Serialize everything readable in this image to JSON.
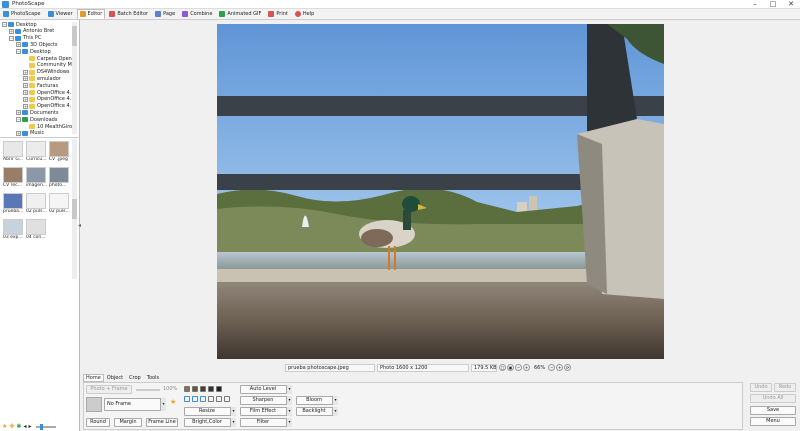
{
  "window": {
    "title": "PhotoScape",
    "minimize": "–",
    "maximize": "□",
    "close": "✕"
  },
  "tabs": [
    {
      "label": "PhotoScape",
      "color": "#3a8fd8"
    },
    {
      "label": "Viewer",
      "color": "#3a8fd8"
    },
    {
      "label": "Editor",
      "color": "#e39a2b"
    },
    {
      "label": "Batch Editor",
      "color": "#d9534f"
    },
    {
      "label": "Page",
      "color": "#5b7fd1"
    },
    {
      "label": "Combine",
      "color": "#8e5bd1"
    },
    {
      "label": "Animated GIF",
      "color": "#2e9e4f"
    },
    {
      "label": "Print",
      "color": "#d9534f"
    },
    {
      "label": "Help",
      "color": "#d9534f"
    }
  ],
  "tree": [
    {
      "label": "Desktop",
      "depth": 0,
      "expander": "−",
      "icon": "blue"
    },
    {
      "label": "Antonio Bret",
      "depth": 1,
      "expander": "+",
      "icon": "blue"
    },
    {
      "label": "This PC",
      "depth": 1,
      "expander": "−",
      "icon": "blue"
    },
    {
      "label": "3D Objects",
      "depth": 2,
      "expander": "+",
      "icon": "blue"
    },
    {
      "label": "Desktop",
      "depth": 2,
      "expander": "−",
      "icon": "blue"
    },
    {
      "label": "Carpeta Openf",
      "depth": 3,
      "expander": "",
      "icon": "folder"
    },
    {
      "label": "Community Ma",
      "depth": 3,
      "expander": "",
      "icon": "folder"
    },
    {
      "label": "DS4Windows",
      "depth": 3,
      "expander": "+",
      "icon": "folder"
    },
    {
      "label": "emulador",
      "depth": 3,
      "expander": "+",
      "icon": "folder"
    },
    {
      "label": "Facturas",
      "depth": 3,
      "expander": "+",
      "icon": "folder"
    },
    {
      "label": "OpenOffice 4.",
      "depth": 3,
      "expander": "+",
      "icon": "folder"
    },
    {
      "label": "OpenOffice 4.",
      "depth": 3,
      "expander": "+",
      "icon": "folder"
    },
    {
      "label": "OpenOffice 4.",
      "depth": 3,
      "expander": "+",
      "icon": "folder"
    },
    {
      "label": "Documents",
      "depth": 2,
      "expander": "+",
      "icon": "blue"
    },
    {
      "label": "Downloads",
      "depth": 2,
      "expander": "−",
      "icon": "green"
    },
    {
      "label": "10 MealthGiro",
      "depth": 3,
      "expander": "",
      "icon": "folder"
    },
    {
      "label": "Music",
      "depth": 2,
      "expander": "+",
      "icon": "blue"
    }
  ],
  "thumbnails": [
    {
      "label": "Abrir G...",
      "color": "#e8e8e8"
    },
    {
      "label": "Curricu...",
      "color": "#ececec"
    },
    {
      "label": "CV .jpeg",
      "color": "#b89a80"
    },
    {
      "label": "CV rec...",
      "color": "#9a7d66"
    },
    {
      "label": "imagen...",
      "color": "#8a98a8"
    },
    {
      "label": "photo...",
      "color": "#7d8a9a"
    },
    {
      "label": "prueba...",
      "color": "#5a78b8"
    },
    {
      "label": "02 puls...",
      "color": "#f0f0f0"
    },
    {
      "label": "02 puls...",
      "color": "#f5f5f5"
    },
    {
      "label": "03 exp...",
      "color": "#c8d2dc"
    },
    {
      "label": "04 con...",
      "color": "#e0e0e0"
    }
  ],
  "status": {
    "filename": "prueba photoscape.jpeg",
    "dimensions": "Photo 1600 x 1200",
    "filesize": "179.5 KB",
    "zoom": "66%"
  },
  "bottom": {
    "tabs": [
      "Home",
      "Object",
      "Crop",
      "Tools"
    ],
    "photo_frame": "Photo + Frame",
    "zoom_value": "100%",
    "frame_name": "No Frame",
    "round": "Round",
    "margin": "Margin",
    "frame_line": "Frame Line",
    "resize": "Resize",
    "bright_color": "Bright,Color",
    "auto_level": "Auto Level",
    "sharpen": "Sharpen",
    "film_effect": "Film Effect",
    "filter": "Filter",
    "bloom": "Bloom",
    "backlight": "Backlight",
    "undo": "Undo",
    "redo": "Redo",
    "undo_all": "Undo All",
    "save": "Save",
    "menu": "Menu"
  },
  "colors": {
    "sky": "#87b8e8",
    "accent": "#3a8fd8"
  }
}
